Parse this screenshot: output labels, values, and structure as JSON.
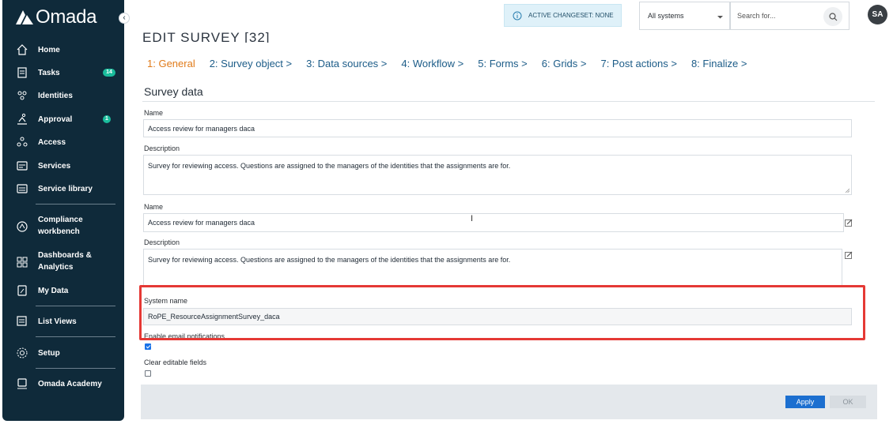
{
  "app": {
    "name": "Omada"
  },
  "sidebar": {
    "items": [
      {
        "label": "Home",
        "icon": "home-icon"
      },
      {
        "label": "Tasks",
        "icon": "tasks-icon",
        "badge": "14"
      },
      {
        "label": "Identities",
        "icon": "identities-icon"
      },
      {
        "label": "Approval",
        "icon": "approval-icon",
        "badge": "1"
      },
      {
        "label": "Access",
        "icon": "access-icon"
      },
      {
        "label": "Services",
        "icon": "services-icon"
      },
      {
        "label": "Service library",
        "icon": "service-library-icon"
      },
      {
        "label": "Compliance",
        "label2": "workbench",
        "icon": "compliance-icon"
      },
      {
        "label": "Dashboards &",
        "label2": "Analytics",
        "icon": "dashboards-icon"
      },
      {
        "label": "My Data",
        "icon": "my-data-icon"
      },
      {
        "label": "List Views",
        "icon": "list-views-icon"
      },
      {
        "label": "Setup",
        "icon": "gear-icon"
      },
      {
        "label": "Omada Academy",
        "icon": "academy-icon"
      }
    ]
  },
  "topbar": {
    "changeset": "ACTIVE CHANGESET: NONE",
    "system_select": "All systems",
    "search_placeholder": "Search for...",
    "avatar_initials": "SA"
  },
  "page": {
    "title": "EDIT SURVEY [32]",
    "steps": [
      "1: General",
      "2: Survey object >",
      "3: Data sources >",
      "4: Workflow >",
      "5: Forms >",
      "6: Grids >",
      "7: Post actions >",
      "8: Finalize >"
    ],
    "section_title": "Survey data"
  },
  "form": {
    "name_label": "Name",
    "name_value": "Access review for managers daca",
    "description_label": "Description",
    "description_value": "Survey for reviewing access. Questions are assigned to the managers of the identities that the assignments are for.",
    "name2_label": "Name",
    "name2_value": "Access review for managers daca",
    "description2_label": "Description",
    "description2_value": "Survey for reviewing access. Questions are assigned to the managers of the identities that the assignments are for.",
    "system_name_label": "System name",
    "system_name_value": "RoPE_ResourceAssignmentSurvey_daca",
    "enable_email_label": "Enable email notifications",
    "enable_email_checked": true,
    "clear_editable_label": "Clear editable fields",
    "clear_editable_checked": false
  },
  "footer": {
    "apply_label": "Apply",
    "ok_label": "OK"
  },
  "colors": {
    "sidebar_bg": "#0f2a3a",
    "accent_orange": "#e07b1a",
    "step_blue": "#1c5c88",
    "badge_green": "#1abc9c",
    "highlight_red": "#e53935",
    "apply_blue": "#1c6fd0"
  }
}
